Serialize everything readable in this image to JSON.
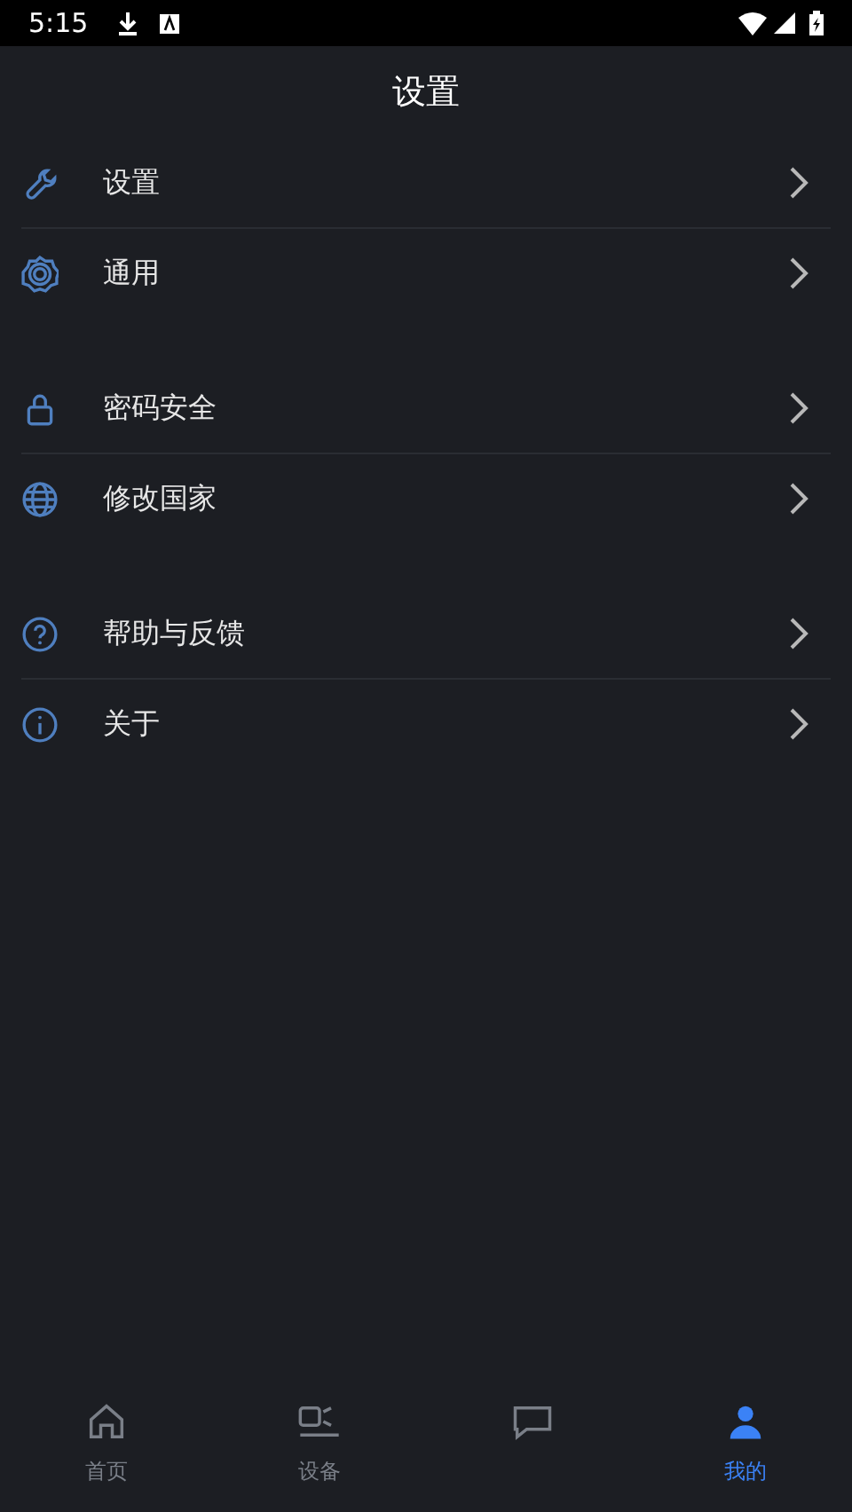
{
  "status_bar": {
    "time": "5:15"
  },
  "header": {
    "title": "设置"
  },
  "groups": [
    {
      "items": [
        {
          "label": "设置"
        },
        {
          "label": "通用"
        }
      ]
    },
    {
      "items": [
        {
          "label": "密码安全"
        },
        {
          "label": "修改国家"
        }
      ]
    },
    {
      "items": [
        {
          "label": "帮助与反馈"
        },
        {
          "label": "关于"
        }
      ]
    }
  ],
  "bottom_nav": [
    {
      "label": "首页",
      "selected": false
    },
    {
      "label": "设备",
      "selected": false
    },
    {
      "selected": false
    },
    {
      "label": "我的",
      "selected": true
    }
  ]
}
